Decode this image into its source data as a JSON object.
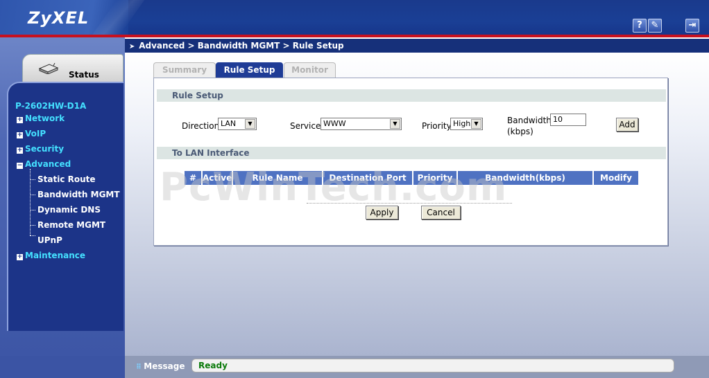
{
  "header": {
    "logo": "ZyXEL",
    "icons": {
      "help": "?",
      "wizard": "✎",
      "logout": "⇥"
    },
    "colors": {
      "brand_blue": "#1a3f95",
      "accent_red": "#c8101e"
    }
  },
  "breadcrumb": "Advanced > Bandwidth MGMT > Rule Setup",
  "sidebar": {
    "status_tab": "Status",
    "model": "P-2602HW-D1A",
    "items": [
      {
        "label": "Network",
        "expander": "+"
      },
      {
        "label": "VoIP",
        "expander": "+"
      },
      {
        "label": "Security",
        "expander": "+"
      },
      {
        "label": "Advanced",
        "expander": "−"
      },
      {
        "label": "Maintenance",
        "expander": "+"
      }
    ],
    "advanced_sub": [
      "Static Route",
      "Bandwidth MGMT",
      "Dynamic DNS",
      "Remote MGMT",
      "UPnP"
    ]
  },
  "tabs": [
    {
      "label": "Summary",
      "active": false
    },
    {
      "label": "Rule Setup",
      "active": true
    },
    {
      "label": "Monitor",
      "active": false
    }
  ],
  "rule_setup": {
    "section_title": "Rule Setup",
    "direction_label": "Direction",
    "direction_value": "LAN",
    "service_label": "Service",
    "service_value": "WWW",
    "priority_label": "Priority",
    "priority_value": "High",
    "bandwidth_label_line1": "Bandwidth",
    "bandwidth_label_line2": "(kbps)",
    "bandwidth_value": "10",
    "add_button": "Add"
  },
  "lan_interface": {
    "section_title": "To LAN Interface",
    "columns": [
      "#",
      "Active",
      "Rule Name",
      "Destination Port",
      "Priority",
      "Bandwidth(kbps)",
      "Modify"
    ],
    "rows": []
  },
  "actions": {
    "apply": "Apply",
    "cancel": "Cancel"
  },
  "watermark": "PcWinTech.com",
  "status_bar": {
    "label": "Message",
    "value": "Ready"
  }
}
